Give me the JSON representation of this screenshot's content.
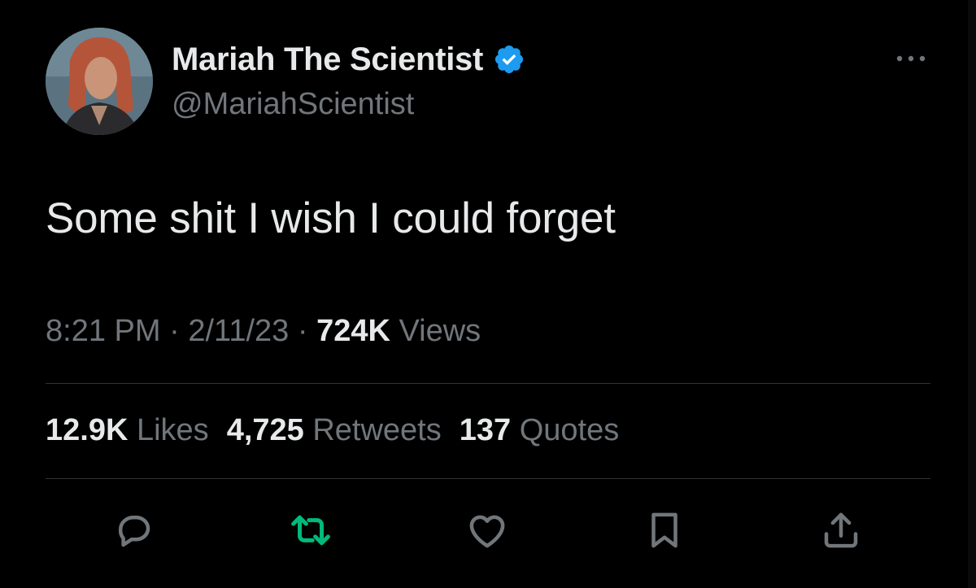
{
  "author": {
    "display_name": "Mariah The Scientist",
    "handle": "@MariahScientist",
    "verified": true,
    "verified_color": "#1d9bf0"
  },
  "tweet": {
    "text": "Some shit I wish I could forget"
  },
  "meta": {
    "time": "8:21 PM",
    "separator": " · ",
    "date": "2/11/23",
    "views_count": "724K",
    "views_label": " Views"
  },
  "stats": {
    "likes_count": "12.9K",
    "likes_label": " Likes",
    "retweets_count": "4,725",
    "retweets_label": " Retweets",
    "quotes_count": "137",
    "quotes_label": " Quotes"
  },
  "actions": {
    "reply_icon": "reply-icon",
    "retweet_icon": "retweet-icon",
    "retweet_color": "#00ba7c",
    "like_icon": "heart-icon",
    "bookmark_icon": "bookmark-icon",
    "share_icon": "share-icon",
    "icon_color": "#71767b"
  }
}
